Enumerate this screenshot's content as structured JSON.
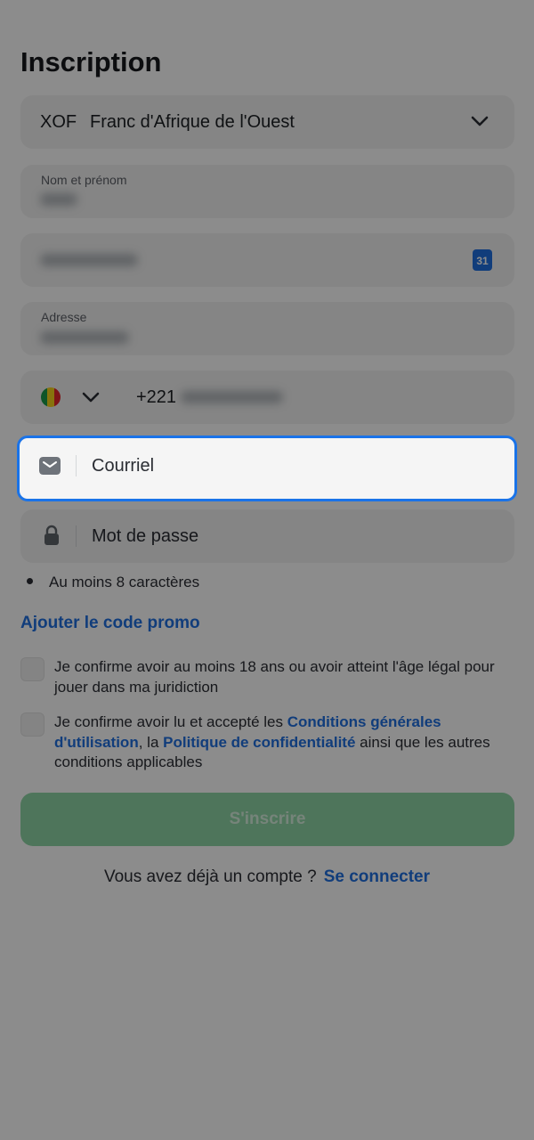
{
  "page": {
    "title": "Inscription"
  },
  "currency": {
    "code": "XOF",
    "name": "Franc d'Afrique de l'Ouest",
    "chevron_icon": "chevron-down-icon"
  },
  "fields": {
    "name": {
      "label": "Nom et prénom"
    },
    "dob": {
      "calendar_day": "31"
    },
    "address": {
      "label": "Adresse"
    },
    "phone": {
      "prefix": "+221",
      "flag": "senegal-flag"
    },
    "email": {
      "placeholder": "Courriel"
    },
    "password": {
      "placeholder": "Mot de passe"
    }
  },
  "password_rule": "Au moins 8 caractères",
  "promo_link": "Ajouter le code promo",
  "checkboxes": {
    "age": {
      "text": "Je confirme avoir au moins 18 ans ou avoir atteint l'âge légal pour jouer dans ma juridiction"
    },
    "terms": {
      "text_before": "Je confirme avoir lu et accepté les ",
      "link1": "Conditions générales d'utilisation",
      "text_mid": ", la ",
      "link2": "Politique de confidentialité",
      "text_after": " ainsi que les autres conditions applicables"
    }
  },
  "submit_label": "S'inscrire",
  "login": {
    "prompt": "Vous avez déjà un compte ?",
    "link": "Se connecter"
  },
  "colors": {
    "accent": "#1f6fe0",
    "focus_border": "#1a73e8",
    "submit_bg": "#8fd5a6",
    "overlay": "rgba(0,0,0,0.45)"
  }
}
